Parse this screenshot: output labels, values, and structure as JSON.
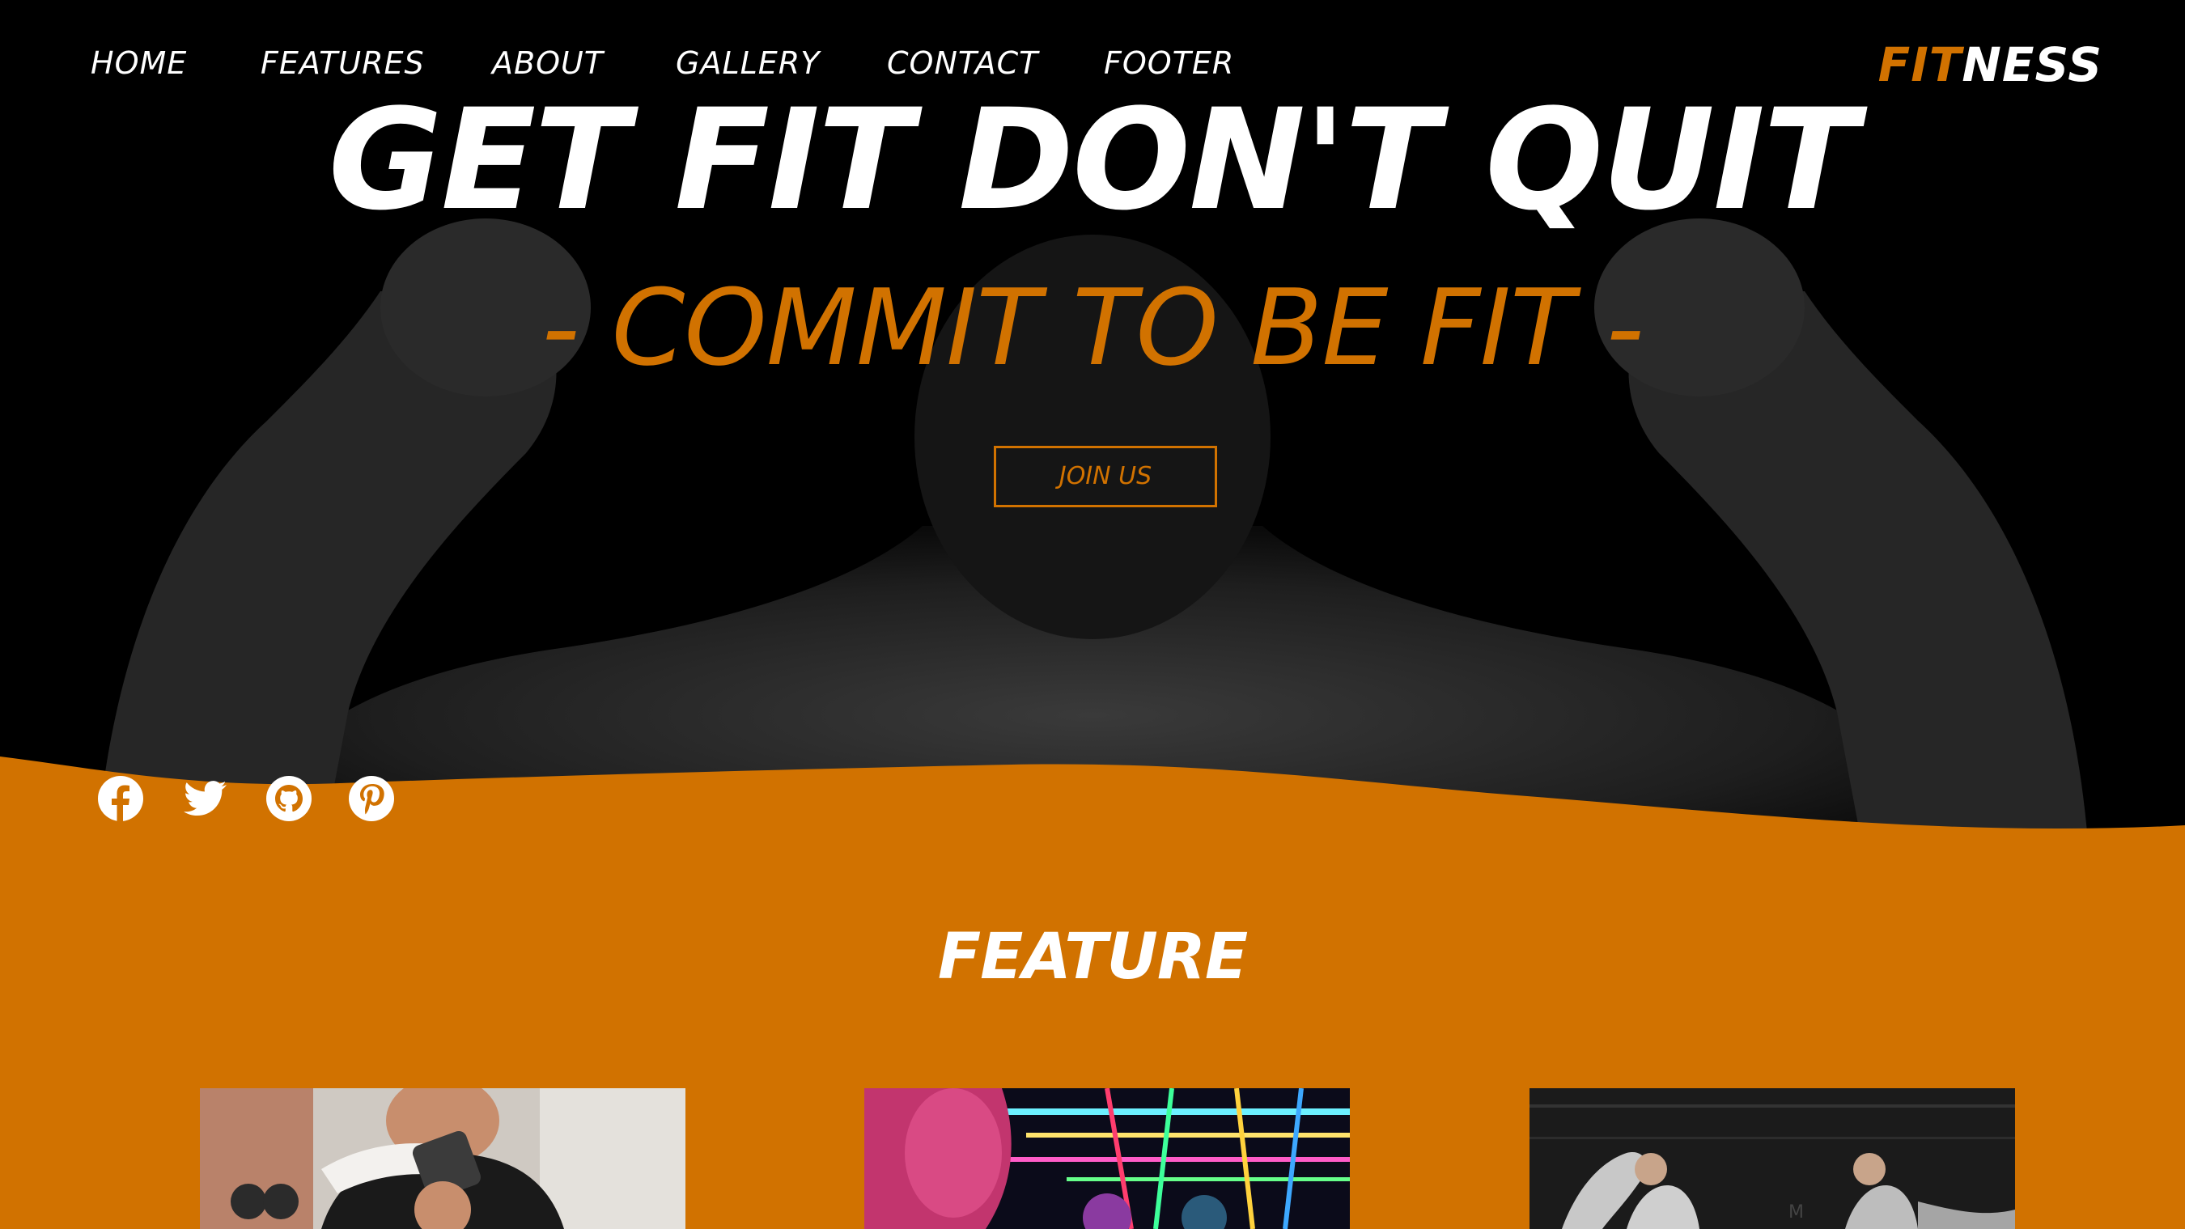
{
  "nav": {
    "items": [
      {
        "label": "HOME"
      },
      {
        "label": "FEATURES"
      },
      {
        "label": "ABOUT"
      },
      {
        "label": "GALLERY"
      },
      {
        "label": "CONTACT"
      },
      {
        "label": "FOOTER"
      }
    ],
    "logo_part1": "FIT",
    "logo_part2": "NESS"
  },
  "hero": {
    "headline": "GET FIT DON'T QUIT",
    "subline": "- COMMIT TO BE FIT -",
    "join_label": "JOIN US"
  },
  "social": {
    "icons": [
      "facebook-icon",
      "twitter-icon",
      "github-icon",
      "pinterest-icon"
    ]
  },
  "feature": {
    "title": "FEATURE"
  },
  "colors": {
    "accent": "#d17200",
    "background": "#000000",
    "text": "#ffffff"
  }
}
